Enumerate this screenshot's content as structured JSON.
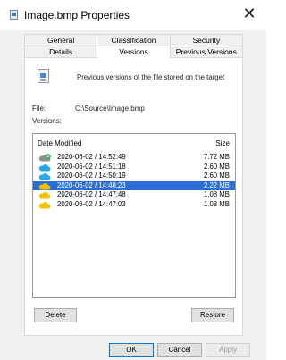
{
  "window": {
    "title": "Image.bmp Properties",
    "close_glyph": "✕",
    "icon": "image-file-icon"
  },
  "tabs": {
    "row1": [
      {
        "label": "General"
      },
      {
        "label": "Classification"
      },
      {
        "label": "Security"
      }
    ],
    "row2": [
      {
        "label": "Details"
      },
      {
        "label": "Versions",
        "active": true
      },
      {
        "label": "Previous Versions"
      }
    ]
  },
  "panel": {
    "description": "Previous versions of the file stored on the target",
    "file_label": "File:",
    "file_value": "C:\\Source\\Image.bmp",
    "versions_label": "Versions:"
  },
  "versions": {
    "columns": {
      "date": "Date Modified",
      "size": "Size"
    },
    "rows": [
      {
        "date": "2020-06-02 / 14:52:49",
        "size": "7.72 MB",
        "icon": "cloud-synced-icon",
        "selected": false
      },
      {
        "date": "2020-06-02 / 14:51:18",
        "size": "2.60 MB",
        "icon": "cloud-blue-icon",
        "selected": false
      },
      {
        "date": "2020-06-02 / 14:50:19",
        "size": "2.60 MB",
        "icon": "cloud-blue-icon",
        "selected": false
      },
      {
        "date": "2020-06-02 / 14:48:23",
        "size": "2.22 MB",
        "icon": "cloud-yellow-icon",
        "selected": true
      },
      {
        "date": "2020-06-02 / 14:47:48",
        "size": "1.08 MB",
        "icon": "cloud-yellow-icon",
        "selected": false
      },
      {
        "date": "2020-06-02 / 14:47:03",
        "size": "1.08 MB",
        "icon": "cloud-yellow-icon",
        "selected": false
      }
    ]
  },
  "buttons": {
    "delete": "Delete",
    "restore": "Restore",
    "ok": "OK",
    "cancel": "Cancel",
    "apply": "Apply"
  },
  "colors": {
    "selection": "#2b6ed6",
    "cloud_gray": "#8f8f8f",
    "cloud_blue": "#29a8e6",
    "cloud_yellow": "#f2c200",
    "sync_badge": "#2fa84f"
  }
}
